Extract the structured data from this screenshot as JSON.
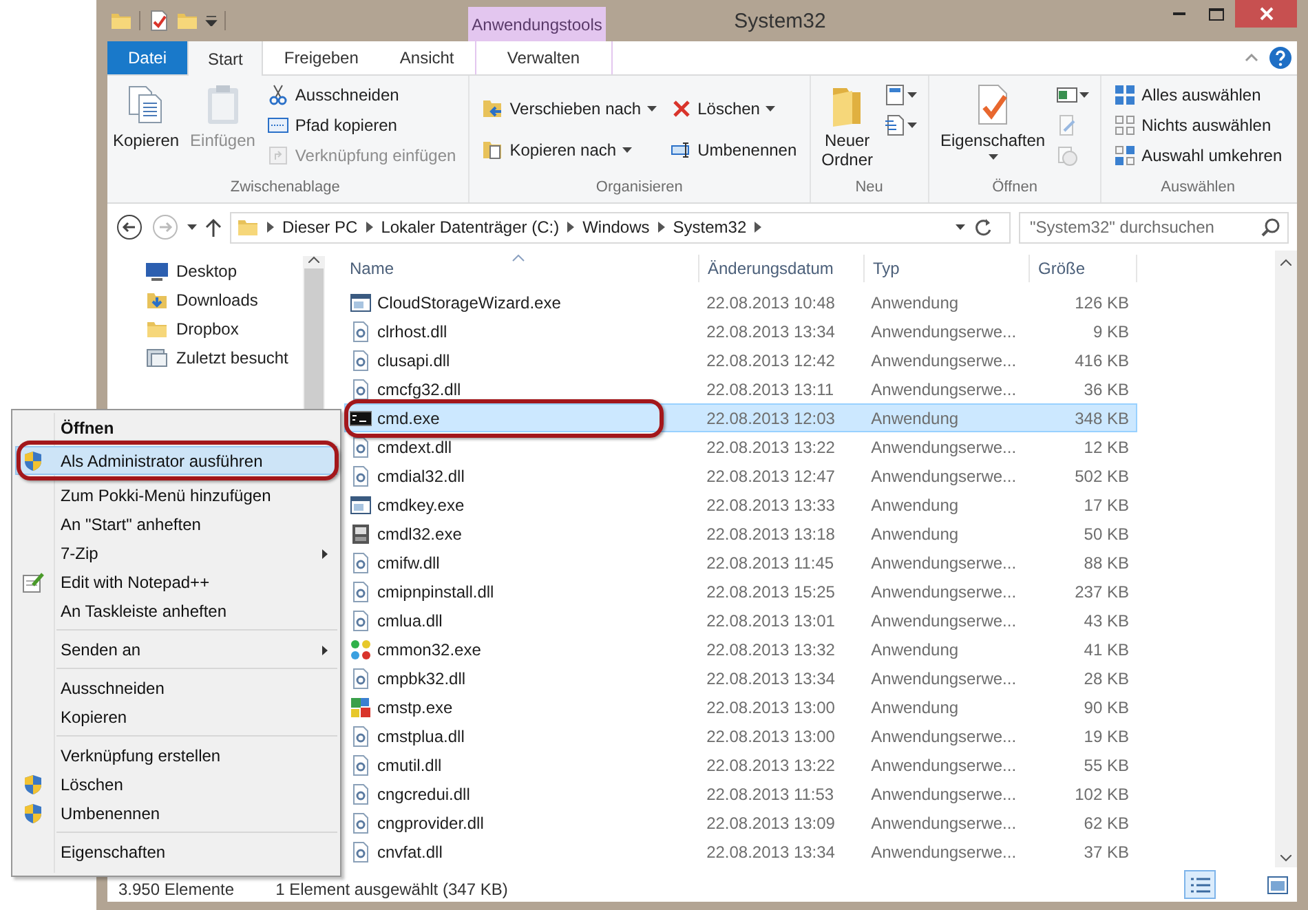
{
  "title_bar": {
    "context_label": "Anwendungstools",
    "title": "System32"
  },
  "ribbon_tabs": [
    {
      "label": "Datei",
      "kind": "file",
      "selected": false
    },
    {
      "label": "Start",
      "kind": "normal",
      "selected": true
    },
    {
      "label": "Freigeben",
      "kind": "normal",
      "selected": false
    },
    {
      "label": "Ansicht",
      "kind": "normal",
      "selected": false
    },
    {
      "label": "Verwalten",
      "kind": "contextual",
      "selected": false
    }
  ],
  "ribbon": {
    "groups": [
      {
        "label": "Zwischenablage",
        "columns": [
          [
            {
              "label": "Kopieren",
              "kind": "large",
              "disabled": false,
              "dropdown": false
            }
          ],
          [
            {
              "label": "Einfügen",
              "kind": "large",
              "disabled": true,
              "dropdown": false
            }
          ],
          [
            {
              "label": "Ausschneiden",
              "kind": "small",
              "disabled": false,
              "dropdown": false
            },
            {
              "label": "Pfad kopieren",
              "kind": "small",
              "disabled": false,
              "dropdown": false
            },
            {
              "label": "Verknüpfung einfügen",
              "kind": "small",
              "disabled": true,
              "dropdown": false
            }
          ]
        ]
      },
      {
        "label": "Organisieren",
        "columns": [
          [
            {
              "label": "Verschieben nach",
              "kind": "small",
              "disabled": false,
              "dropdown": true
            },
            {
              "label": "Kopieren nach",
              "kind": "small",
              "disabled": false,
              "dropdown": true
            }
          ],
          [
            {
              "label": "Löschen",
              "kind": "small",
              "disabled": false,
              "dropdown": true
            },
            {
              "label": "Umbenennen",
              "kind": "small",
              "disabled": false,
              "dropdown": false
            }
          ]
        ]
      },
      {
        "label": "Neu",
        "columns": [
          [
            {
              "label": "Neuer Ordner",
              "kind": "large",
              "disabled": false,
              "dropdown": false
            }
          ],
          [
            {
              "kind": "tool",
              "disabled": false,
              "dropdown": true
            },
            {
              "kind": "tool",
              "disabled": false,
              "dropdown": true
            }
          ]
        ]
      },
      {
        "label": "Öffnen",
        "columns": [
          [
            {
              "label": "Eigenschaften",
              "kind": "large",
              "disabled": false,
              "dropdown": true
            }
          ],
          [
            {
              "kind": "tool",
              "disabled": false,
              "dropdown": true
            },
            {
              "kind": "tool",
              "disabled": true,
              "dropdown": false
            },
            {
              "kind": "tool",
              "disabled": true,
              "dropdown": false
            }
          ]
        ]
      },
      {
        "label": "Auswählen",
        "columns": [
          [
            {
              "label": "Alles auswählen",
              "kind": "small",
              "disabled": false,
              "dropdown": false
            },
            {
              "label": "Nichts auswählen",
              "kind": "small",
              "disabled": false,
              "dropdown": false
            },
            {
              "label": "Auswahl umkehren",
              "kind": "small",
              "disabled": false,
              "dropdown": false
            }
          ]
        ]
      }
    ]
  },
  "address": {
    "path": [
      "Dieser PC",
      "Lokaler Datenträger (C:)",
      "Windows",
      "System32"
    ],
    "search_placeholder": "\"System32\" durchsuchen"
  },
  "nav_items": [
    {
      "label": "Desktop",
      "kind": "desktop"
    },
    {
      "label": "Downloads",
      "kind": "downloads"
    },
    {
      "label": "Dropbox",
      "kind": "folder"
    },
    {
      "label": "Zuletzt besucht",
      "kind": "recent"
    }
  ],
  "file_list": {
    "columns": [
      "Name",
      "Änderungsdatum",
      "Typ",
      "Größe"
    ],
    "rows": [
      {
        "name": "CloudStorageWizard.exe",
        "date": "22.08.2013 10:48",
        "type": "Anwendung",
        "size": "126 KB",
        "kind": "app",
        "selected": false
      },
      {
        "name": "clrhost.dll",
        "date": "22.08.2013 13:34",
        "type": "Anwendungserwe...",
        "size": "9 KB",
        "kind": "library",
        "selected": false
      },
      {
        "name": "clusapi.dll",
        "date": "22.08.2013 12:42",
        "type": "Anwendungserwe...",
        "size": "416 KB",
        "kind": "library",
        "selected": false
      },
      {
        "name": "cmcfg32.dll",
        "date": "22.08.2013 13:11",
        "type": "Anwendungserwe...",
        "size": "36 KB",
        "kind": "library",
        "selected": false
      },
      {
        "name": "cmd.exe",
        "date": "22.08.2013 12:03",
        "type": "Anwendung",
        "size": "348 KB",
        "kind": "console",
        "selected": true
      },
      {
        "name": "cmdext.dll",
        "date": "22.08.2013 13:22",
        "type": "Anwendungserwe...",
        "size": "12 KB",
        "kind": "library",
        "selected": false
      },
      {
        "name": "cmdial32.dll",
        "date": "22.08.2013 12:47",
        "type": "Anwendungserwe...",
        "size": "502 KB",
        "kind": "library",
        "selected": false
      },
      {
        "name": "cmdkey.exe",
        "date": "22.08.2013 13:33",
        "type": "Anwendung",
        "size": "17 KB",
        "kind": "app",
        "selected": false
      },
      {
        "name": "cmdl32.exe",
        "date": "22.08.2013 13:18",
        "type": "Anwendung",
        "size": "50 KB",
        "kind": "setup",
        "selected": false
      },
      {
        "name": "cmifw.dll",
        "date": "22.08.2013 11:45",
        "type": "Anwendungserwe...",
        "size": "88 KB",
        "kind": "library",
        "selected": false
      },
      {
        "name": "cmipnpinstall.dll",
        "date": "22.08.2013 15:25",
        "type": "Anwendungserwe...",
        "size": "237 KB",
        "kind": "library",
        "selected": false
      },
      {
        "name": "cmlua.dll",
        "date": "22.08.2013 13:01",
        "type": "Anwendungserwe...",
        "size": "43 KB",
        "kind": "library",
        "selected": false
      },
      {
        "name": "cmmon32.exe",
        "date": "22.08.2013 13:32",
        "type": "Anwendung",
        "size": "41 KB",
        "kind": "monitor",
        "selected": false
      },
      {
        "name": "cmpbk32.dll",
        "date": "22.08.2013 13:34",
        "type": "Anwendungserwe...",
        "size": "28 KB",
        "kind": "library",
        "selected": false
      },
      {
        "name": "cmstp.exe",
        "date": "22.08.2013 13:00",
        "type": "Anwendung",
        "size": "90 KB",
        "kind": "profile",
        "selected": false
      },
      {
        "name": "cmstplua.dll",
        "date": "22.08.2013 13:00",
        "type": "Anwendungserwe...",
        "size": "19 KB",
        "kind": "library",
        "selected": false
      },
      {
        "name": "cmutil.dll",
        "date": "22.08.2013 13:22",
        "type": "Anwendungserwe...",
        "size": "55 KB",
        "kind": "library",
        "selected": false
      },
      {
        "name": "cngcredui.dll",
        "date": "22.08.2013 11:53",
        "type": "Anwendungserwe...",
        "size": "102 KB",
        "kind": "library",
        "selected": false
      },
      {
        "name": "cngprovider.dll",
        "date": "22.08.2013 13:09",
        "type": "Anwendungserwe...",
        "size": "62 KB",
        "kind": "library",
        "selected": false
      },
      {
        "name": "cnvfat.dll",
        "date": "22.08.2013 13:34",
        "type": "Anwendungserwe...",
        "size": "37 KB",
        "kind": "library",
        "selected": false
      }
    ]
  },
  "status_bar": {
    "items": [
      "3.950 Elemente",
      "1 Element ausgewählt (347 KB)"
    ],
    "views": [
      {
        "kind": "details",
        "selected": true
      },
      {
        "kind": "thumbnails",
        "selected": false
      }
    ]
  },
  "context_menu": {
    "items": [
      {
        "kind": "item",
        "label": "Öffnen",
        "default": true,
        "submenu": false,
        "selected": false
      },
      {
        "kind": "item",
        "label": "Als Administrator ausführen",
        "default": false,
        "submenu": false,
        "selected": true
      },
      {
        "kind": "item",
        "label": "Zum Pokki-Menü hinzufügen",
        "default": false,
        "submenu": false,
        "selected": false
      },
      {
        "kind": "item",
        "label": "An \"Start\" anheften",
        "default": false,
        "submenu": false,
        "selected": false
      },
      {
        "kind": "item",
        "label": "7-Zip",
        "default": false,
        "submenu": true,
        "selected": false
      },
      {
        "kind": "item",
        "label": "Edit with Notepad++",
        "default": false,
        "submenu": false,
        "selected": false
      },
      {
        "kind": "item",
        "label": "An Taskleiste anheften",
        "default": false,
        "submenu": false,
        "selected": false
      },
      {
        "kind": "separator"
      },
      {
        "kind": "item",
        "label": "Senden an",
        "default": false,
        "submenu": true,
        "selected": false
      },
      {
        "kind": "separator"
      },
      {
        "kind": "item",
        "label": "Ausschneiden",
        "default": false,
        "submenu": false,
        "selected": false
      },
      {
        "kind": "item",
        "label": "Kopieren",
        "default": false,
        "submenu": false,
        "selected": false
      },
      {
        "kind": "separator"
      },
      {
        "kind": "item",
        "label": "Verknüpfung erstellen",
        "default": false,
        "submenu": false,
        "selected": false
      },
      {
        "kind": "item",
        "label": "Löschen",
        "default": false,
        "submenu": false,
        "selected": false
      },
      {
        "kind": "item",
        "label": "Umbenennen",
        "default": false,
        "submenu": false,
        "selected": false
      },
      {
        "kind": "separator"
      },
      {
        "kind": "item",
        "label": "Eigenschaften",
        "default": false,
        "submenu": false,
        "selected": false
      }
    ]
  }
}
